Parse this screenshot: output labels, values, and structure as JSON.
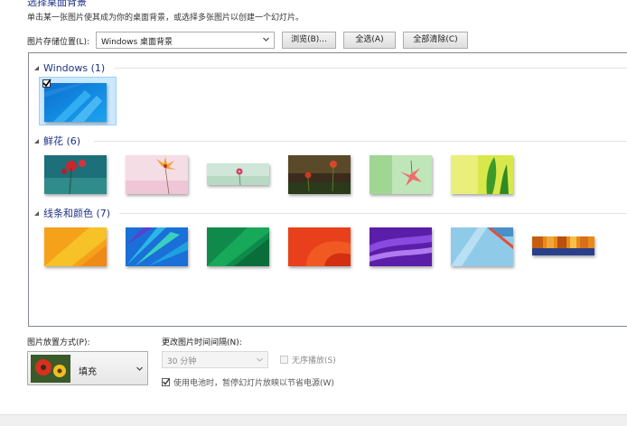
{
  "header": {
    "title": "选择桌面背景",
    "subtitle": "单击某一张图片使其成为你的桌面背景，或选择多张图片以创建一个幻灯片。"
  },
  "location": {
    "label": "图片存储位置(L):",
    "value": "Windows 桌面背景",
    "browse_label": "浏览(B)...",
    "select_all_label": "全选(A)",
    "clear_all_label": "全部清除(C)"
  },
  "gallery": {
    "groups": [
      {
        "name": "Windows (1)",
        "count": 1,
        "selected": [
          true
        ]
      },
      {
        "name": "鲜花 (6)",
        "count": 6
      },
      {
        "name": "线条和颜色 (7)",
        "count": 7
      }
    ]
  },
  "position": {
    "label": "图片放置方式(P):",
    "value": "填充",
    "icon": "flower-thumbnail"
  },
  "interval": {
    "label": "更改图片时间间隔(N):",
    "value": "30 分钟",
    "enabled": false,
    "shuffle_label": "无序播放(S)",
    "shuffle_checked": false,
    "battery_label": "使用电池时，暂停幻灯片放映以节省电源(W)",
    "battery_checked": true
  },
  "colors": {
    "group_header": "#1e3287",
    "selection": "#cce8ff"
  }
}
